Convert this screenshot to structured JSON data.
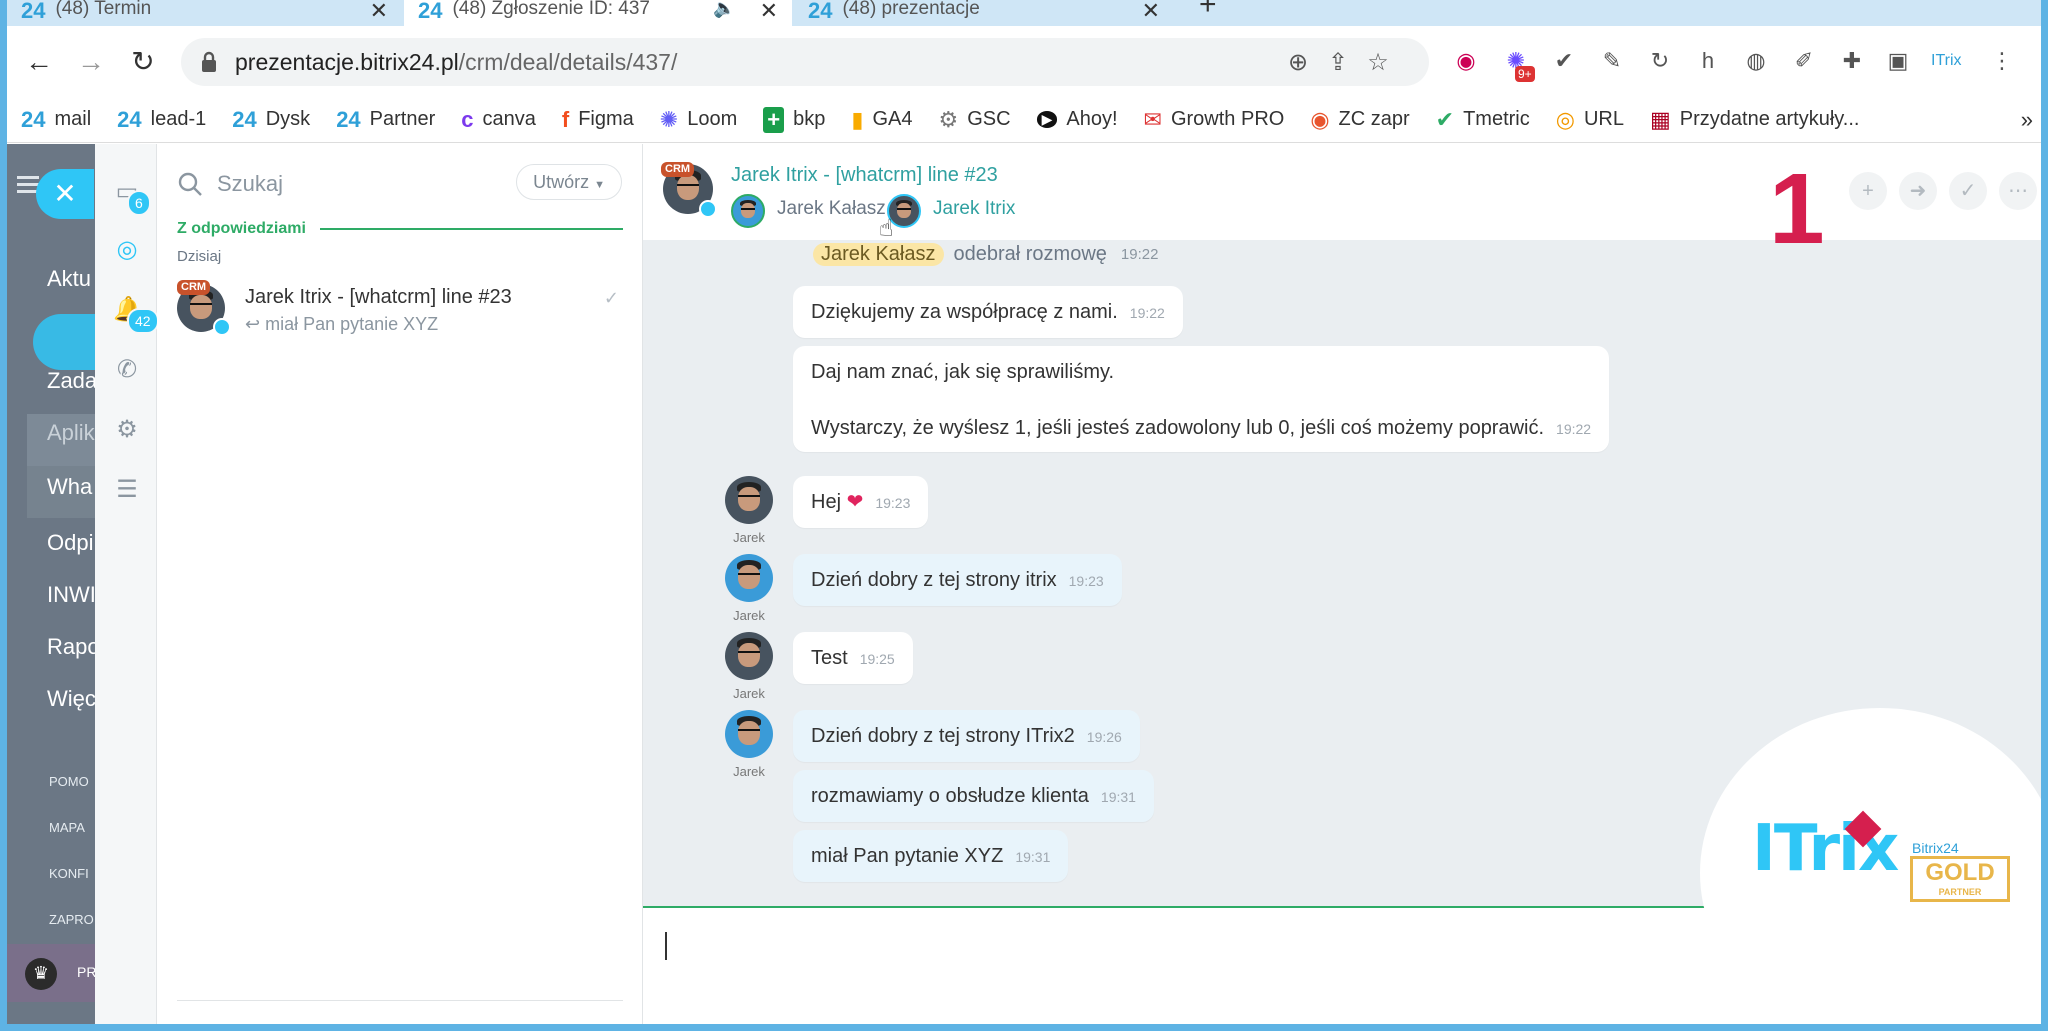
{
  "browser": {
    "tabs": [
      {
        "label": "(48) Termin",
        "icon": "24"
      },
      {
        "label": "(48) Zgłoszenie ID: 437",
        "icon": "24"
      },
      {
        "label": "(48) prezentacje",
        "icon": "24"
      }
    ],
    "new_tab": "+",
    "url_host": "prezentacje.bitrix24.pl",
    "url_path": "/crm/deal/details/437/",
    "ext_badge": "9+"
  },
  "bookmarks": [
    {
      "label": "mail",
      "icon": "24"
    },
    {
      "label": "lead-1",
      "icon": "24"
    },
    {
      "label": "Dysk",
      "icon": "24"
    },
    {
      "label": "Partner",
      "icon": "24"
    },
    {
      "label": "canva",
      "icon": "c"
    },
    {
      "label": "Figma",
      "icon": "f"
    },
    {
      "label": "Loom",
      "icon": "✺"
    },
    {
      "label": "bkp",
      "icon": "+"
    },
    {
      "label": "GA4",
      "icon": "▮"
    },
    {
      "label": "GSC",
      "icon": "⚙"
    },
    {
      "label": "Ahoy!",
      "icon": "▶"
    },
    {
      "label": "Growth PRO",
      "icon": "✉"
    },
    {
      "label": "ZC zapr",
      "icon": "◉"
    },
    {
      "label": "Tmetric",
      "icon": "✔"
    },
    {
      "label": "URL",
      "icon": "◎"
    },
    {
      "label": "Przydatne artykuły...",
      "icon": "▦"
    }
  ],
  "bx_menu": {
    "items": [
      "Aktu",
      "Zada",
      "Aplik",
      "Wha",
      "Odpi",
      "INWI",
      "Rapo",
      "Więc"
    ],
    "small": [
      "POMO",
      "MAPA",
      "KONFI",
      "ZAPRO"
    ],
    "bottom": "PR"
  },
  "msgbar": {
    "badge_chats": "6",
    "badge_open": "42"
  },
  "recent": {
    "search_placeholder": "Szukaj",
    "create_label": "Utwórz",
    "section_title": "Z odpowiedziami",
    "today_label": "Dzisiaj",
    "item_title": "Jarek Itrix - [whatcrm] line #23",
    "item_last": "miał Pan pytanie XYZ",
    "crm_tag": "CRM"
  },
  "chat": {
    "title": "Jarek Itrix - [whatcrm] line #23",
    "participant_1": "Jarek Kałasz",
    "participant_2": "Jarek Itrix",
    "system_name": "Jarek Kałasz",
    "system_text": "odebrał rozmowę",
    "system_time": "19:22",
    "messages": [
      {
        "text": "Dziękujemy za współpracę z nami.",
        "time": "19:22"
      },
      {
        "line1": "Daj nam znać, jak się sprawiliśmy.",
        "line2": "Wystarczy, że wyślesz 1, jeśli jesteś zadowolony lub 0, jeśli coś możemy poprawić.",
        "time": "19:22"
      },
      {
        "text": "Hej",
        "emoji": "❤",
        "time": "19:23",
        "author": "Jarek"
      },
      {
        "text": "Dzień dobry z tej strony itrix",
        "time": "19:23",
        "author": "Jarek"
      },
      {
        "text": "Test",
        "time": "19:25",
        "author": "Jarek"
      },
      {
        "text": "Dzień dobry z tej strony ITrix2",
        "time": "19:26",
        "author": "Jarek"
      },
      {
        "text": "rozmawiamy o obsłudze klienta",
        "time": "19:31"
      },
      {
        "text": "miał Pan pytanie XYZ",
        "time": "19:31"
      }
    ]
  },
  "overlay": {
    "number": "1",
    "logo_text": "ITrix",
    "logo_brand": "Bitrix24",
    "logo_gold": "GOLD",
    "logo_partner": "PARTNER"
  },
  "colors": {
    "accent": "#2fc6f6",
    "green": "#2eab66",
    "number": "#d51f4e"
  }
}
